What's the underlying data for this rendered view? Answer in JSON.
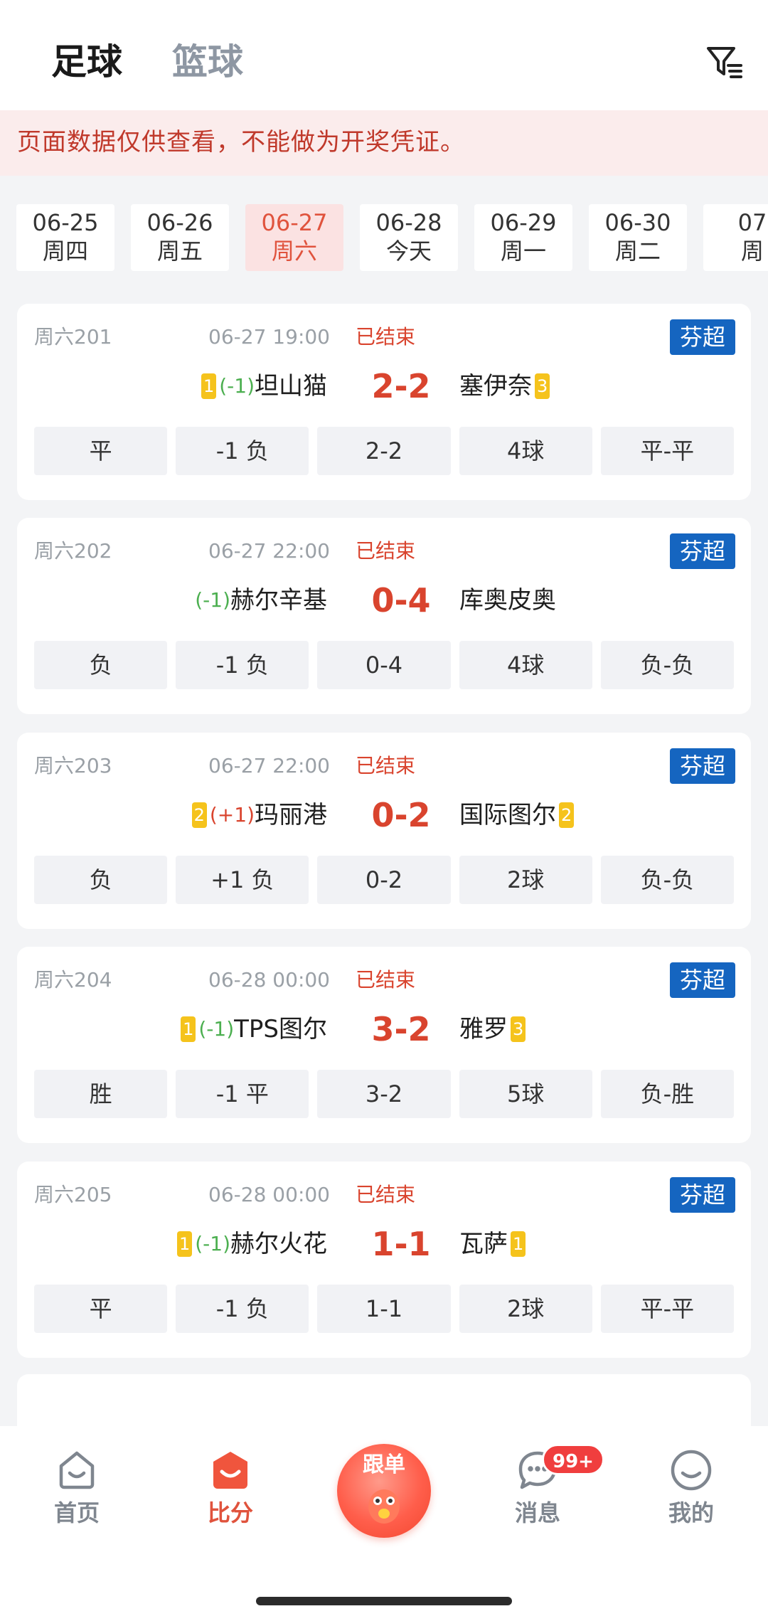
{
  "header": {
    "tabs": [
      {
        "label": "足球",
        "active": true
      },
      {
        "label": "篮球",
        "active": false
      }
    ],
    "filter_icon": "filter-icon"
  },
  "notice": {
    "text": "页面数据仅供查看，不能做为开奖凭证。"
  },
  "dates": [
    {
      "date": "06-25",
      "weekday": "周四",
      "active": false
    },
    {
      "date": "06-26",
      "weekday": "周五",
      "active": false
    },
    {
      "date": "06-27",
      "weekday": "周六",
      "active": true
    },
    {
      "date": "06-28",
      "weekday": "今天",
      "active": false
    },
    {
      "date": "06-29",
      "weekday": "周一",
      "active": false
    },
    {
      "date": "06-30",
      "weekday": "周二",
      "active": false
    },
    {
      "date": "07",
      "weekday": "周",
      "active": false
    }
  ],
  "matches": [
    {
      "no": "周六201",
      "time": "06-27 19:00",
      "status": "已结束",
      "league": "芬超",
      "home_rank": "1",
      "home_handicap": "(-1)",
      "home": "坦山猫",
      "score": "2-2",
      "away": "塞伊奈",
      "away_rank": "3",
      "results": [
        "平",
        "-1 负",
        "2-2",
        "4球",
        "平-平"
      ]
    },
    {
      "no": "周六202",
      "time": "06-27 22:00",
      "status": "已结束",
      "league": "芬超",
      "home_rank": "",
      "home_handicap": "(-1)",
      "home": "赫尔辛基",
      "score": "0-4",
      "away": "库奥皮奥",
      "away_rank": "",
      "results": [
        "负",
        "-1 负",
        "0-4",
        "4球",
        "负-负"
      ]
    },
    {
      "no": "周六203",
      "time": "06-27 22:00",
      "status": "已结束",
      "league": "芬超",
      "home_rank": "2",
      "home_handicap": "(+1)",
      "home": "玛丽港",
      "score": "0-2",
      "away": "国际图尔",
      "away_rank": "2",
      "results": [
        "负",
        "+1 负",
        "0-2",
        "2球",
        "负-负"
      ]
    },
    {
      "no": "周六204",
      "time": "06-28 00:00",
      "status": "已结束",
      "league": "芬超",
      "home_rank": "1",
      "home_handicap": "(-1)",
      "home": "TPS图尔",
      "score": "3-2",
      "away": "雅罗",
      "away_rank": "3",
      "results": [
        "胜",
        "-1 平",
        "3-2",
        "5球",
        "负-胜"
      ]
    },
    {
      "no": "周六205",
      "time": "06-28 00:00",
      "status": "已结束",
      "league": "芬超",
      "home_rank": "1",
      "home_handicap": "(-1)",
      "home": "赫尔火花",
      "score": "1-1",
      "away": "瓦萨",
      "away_rank": "1",
      "results": [
        "平",
        "-1 负",
        "1-1",
        "2球",
        "平-平"
      ]
    }
  ],
  "tabbar": {
    "items": [
      {
        "label": "首页",
        "icon": "home-icon",
        "active": false
      },
      {
        "label": "比分",
        "icon": "score-icon",
        "active": true
      },
      {
        "label": "跟单",
        "icon": "follow-mascot-icon",
        "active": false
      },
      {
        "label": "消息",
        "icon": "message-icon",
        "active": false
      },
      {
        "label": "我的",
        "icon": "profile-icon",
        "active": false
      }
    ],
    "message_badge": "99+"
  },
  "colors": {
    "accent_red": "#d9442e",
    "league_blue": "#1565c0",
    "rank_yellow": "#f5c31c",
    "handicap_green": "#4caf50"
  }
}
